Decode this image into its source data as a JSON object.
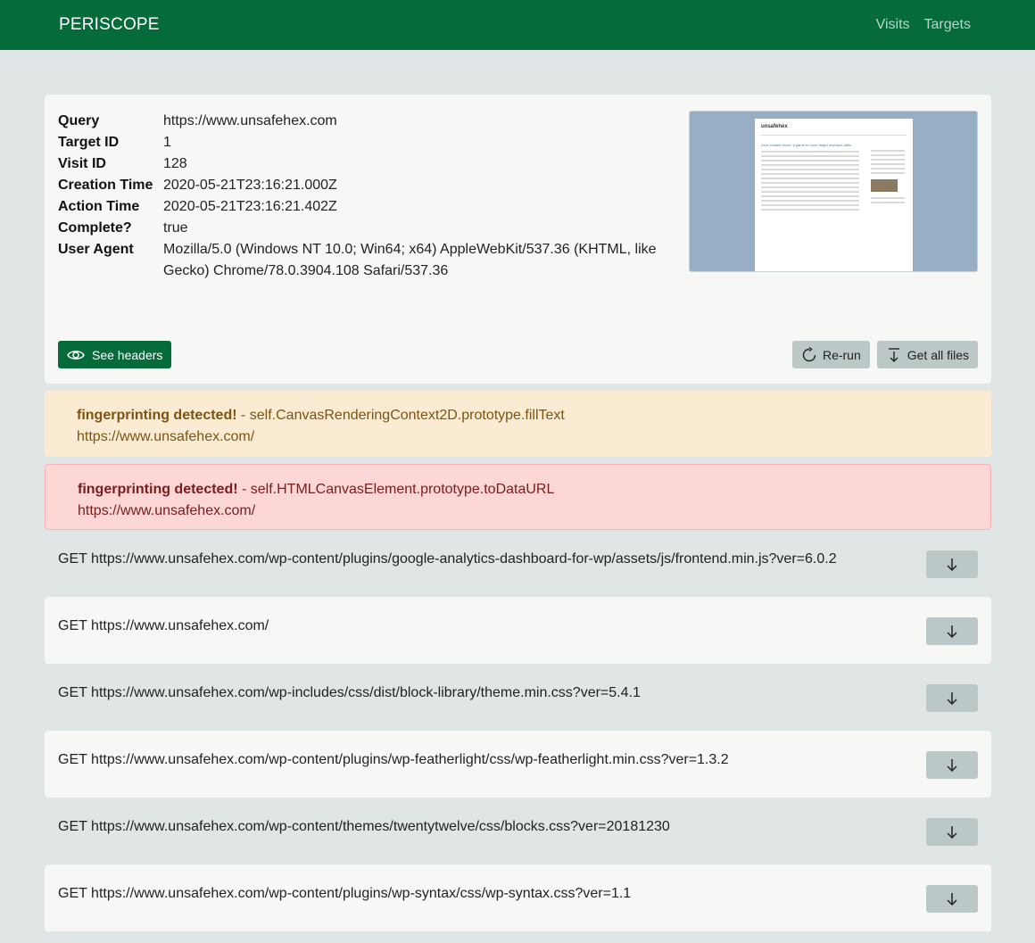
{
  "nav": {
    "brand": "PERISCOPE",
    "links": [
      "Visits",
      "Targets"
    ]
  },
  "visit": {
    "fields": [
      {
        "key": "Query",
        "value": "https://www.unsafehex.com"
      },
      {
        "key": "Target ID",
        "value": "1"
      },
      {
        "key": "Visit ID",
        "value": "128"
      },
      {
        "key": "Creation Time",
        "value": "2020-05-21T23:16:21.000Z"
      },
      {
        "key": "Action Time",
        "value": "2020-05-21T23:16:21.402Z"
      },
      {
        "key": "Complete?",
        "value": "true"
      },
      {
        "key": "User Agent",
        "value": "Mozilla/5.0 (Windows NT 10.0; Win64; x64) AppleWebKit/537.36 (KHTML, like Gecko) Chrome/78.0.3904.108 Safari/537.36"
      }
    ],
    "see_headers_label": "See headers",
    "rerun_label": "Re-run",
    "get_all_files_label": "Get all files",
    "thumbnail": {
      "site_title": "unsafehex",
      "post_title": "Zero contact recon: a game to hone target research skills"
    }
  },
  "alerts": [
    {
      "level": "warning",
      "title": "fingerprinting detected!",
      "detail": " - self.CanvasRenderingContext2D.prototype.fillText",
      "url": "https://www.unsafehex.com/"
    },
    {
      "level": "danger",
      "title": "fingerprinting detected!",
      "detail": " - self.HTMLCanvasElement.prototype.toDataURL",
      "url": "https://www.unsafehex.com/"
    }
  ],
  "requests": [
    "GET https://www.unsafehex.com/wp-content/plugins/google-analytics-dashboard-for-wp/assets/js/frontend.min.js?ver=6.0.2",
    "GET https://www.unsafehex.com/",
    "GET https://www.unsafehex.com/wp-includes/css/dist/block-library/theme.min.css?ver=5.4.1",
    "GET https://www.unsafehex.com/wp-content/plugins/wp-featherlight/css/wp-featherlight.min.css?ver=1.3.2",
    "GET https://www.unsafehex.com/wp-content/themes/twentytwelve/css/blocks.css?ver=20181230",
    "GET https://www.unsafehex.com/wp-content/plugins/wp-syntax/css/wp-syntax.css?ver=1.1"
  ],
  "icons": {
    "eye": "eye-icon",
    "rerun": "refresh-icon",
    "download_all": "download-all-icon",
    "download": "arrow-down-icon"
  },
  "colors": {
    "nav": "#056b3b",
    "primary": "#056b3b",
    "warning_bg": "#fcebd3",
    "danger_bg": "#fdd6d6"
  }
}
